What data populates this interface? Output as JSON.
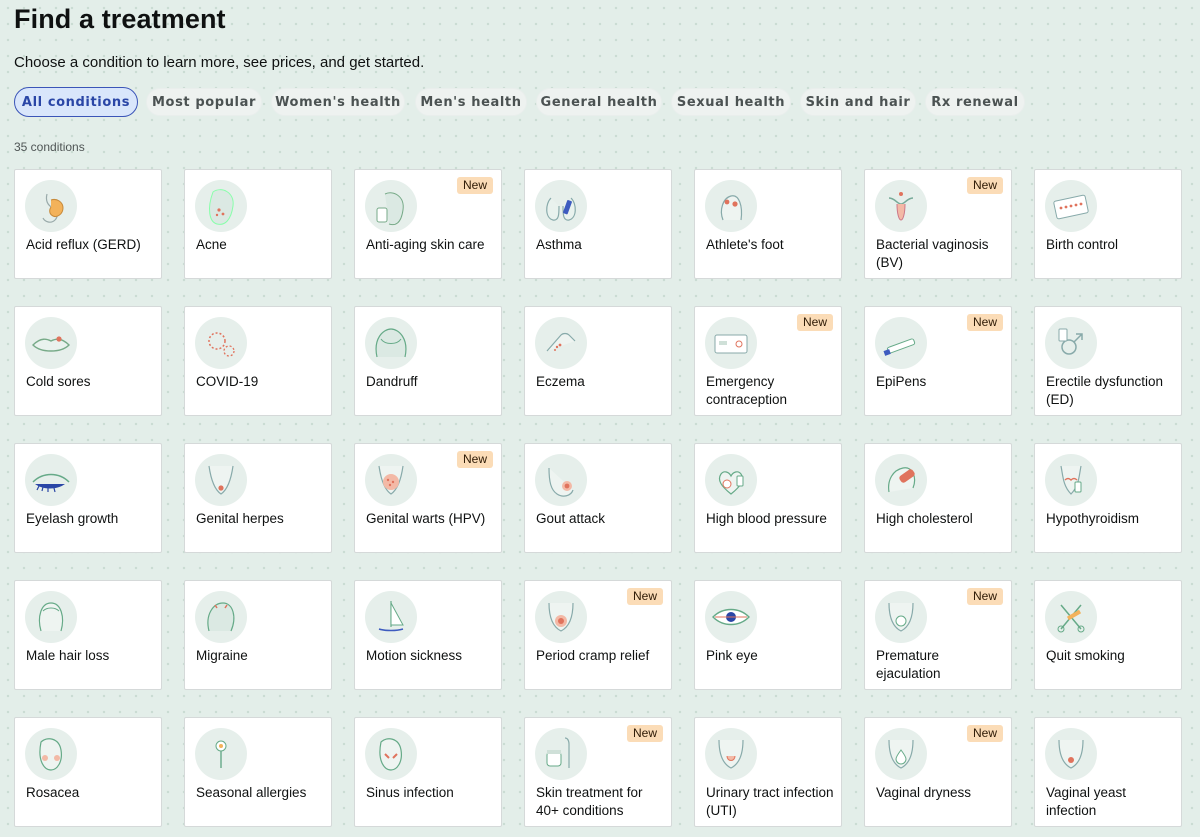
{
  "header": {
    "title": "Find a treatment",
    "subtitle": "Choose a condition to learn more, see prices, and get started.",
    "count": "35 conditions"
  },
  "filters": [
    {
      "label": "All conditions",
      "active": true
    },
    {
      "label": "Most popular",
      "active": false
    },
    {
      "label": "Women's health",
      "active": false
    },
    {
      "label": "Men's health",
      "active": false
    },
    {
      "label": "General health",
      "active": false
    },
    {
      "label": "Sexual health",
      "active": false
    },
    {
      "label": "Skin and hair",
      "active": false
    },
    {
      "label": "Rx renewal",
      "active": false
    }
  ],
  "badge_label": "New",
  "colors": {
    "accent": "#2a46a6",
    "badge_bg": "#fbdcb7",
    "page_bg": "#e3eee9",
    "icon_bg": "#e6efeb"
  },
  "conditions": [
    {
      "label": "Acid reflux (GERD)",
      "icon": "stomach-icon",
      "new": false
    },
    {
      "label": "Acne",
      "icon": "face-acne-icon",
      "new": false
    },
    {
      "label": "Anti-aging skin care",
      "icon": "face-skincare-icon",
      "new": true
    },
    {
      "label": "Asthma",
      "icon": "lungs-inhaler-icon",
      "new": false
    },
    {
      "label": "Athlete's foot",
      "icon": "foot-icon",
      "new": false
    },
    {
      "label": "Bacterial vaginosis (BV)",
      "icon": "uterus-icon",
      "new": true
    },
    {
      "label": "Birth control",
      "icon": "pill-pack-icon",
      "new": false
    },
    {
      "label": "Cold sores",
      "icon": "lips-icon",
      "new": false
    },
    {
      "label": "COVID-19",
      "icon": "virus-icon",
      "new": false
    },
    {
      "label": "Dandruff",
      "icon": "head-hair-icon",
      "new": false
    },
    {
      "label": "Eczema",
      "icon": "hand-rash-icon",
      "new": false
    },
    {
      "label": "Emergency contraception",
      "icon": "pill-box-icon",
      "new": true
    },
    {
      "label": "EpiPens",
      "icon": "epipen-icon",
      "new": true
    },
    {
      "label": "Erectile dysfunction (ED)",
      "icon": "male-symbol-icon",
      "new": false
    },
    {
      "label": "Eyelash growth",
      "icon": "eyelash-icon",
      "new": false
    },
    {
      "label": "Genital herpes",
      "icon": "pelvis-icon",
      "new": false
    },
    {
      "label": "Genital warts (HPV)",
      "icon": "pelvis-warts-icon",
      "new": true
    },
    {
      "label": "Gout attack",
      "icon": "foot-gout-icon",
      "new": false
    },
    {
      "label": "High blood pressure",
      "icon": "heart-gauge-icon",
      "new": false
    },
    {
      "label": "High cholesterol",
      "icon": "artery-icon",
      "new": false
    },
    {
      "label": "Hypothyroidism",
      "icon": "thyroid-icon",
      "new": false
    },
    {
      "label": "Male hair loss",
      "icon": "male-head-icon",
      "new": false
    },
    {
      "label": "Migraine",
      "icon": "head-migraine-icon",
      "new": false
    },
    {
      "label": "Motion sickness",
      "icon": "sailboat-icon",
      "new": false
    },
    {
      "label": "Period cramp relief",
      "icon": "abdomen-cramp-icon",
      "new": true
    },
    {
      "label": "Pink eye",
      "icon": "eye-icon",
      "new": false
    },
    {
      "label": "Premature ejaculation",
      "icon": "torso-timer-icon",
      "new": true
    },
    {
      "label": "Quit smoking",
      "icon": "scissors-cigarette-icon",
      "new": false
    },
    {
      "label": "Rosacea",
      "icon": "face-rosacea-icon",
      "new": false
    },
    {
      "label": "Seasonal allergies",
      "icon": "flower-icon",
      "new": false
    },
    {
      "label": "Sinus infection",
      "icon": "face-sinus-icon",
      "new": false
    },
    {
      "label": "Skin treatment for 40+ conditions",
      "icon": "body-jar-icon",
      "new": true
    },
    {
      "label": "Urinary tract infection (UTI)",
      "icon": "bladder-icon",
      "new": false
    },
    {
      "label": "Vaginal dryness",
      "icon": "torso-drop-icon",
      "new": true
    },
    {
      "label": "Vaginal yeast infection",
      "icon": "torso-yeast-icon",
      "new": false
    }
  ]
}
